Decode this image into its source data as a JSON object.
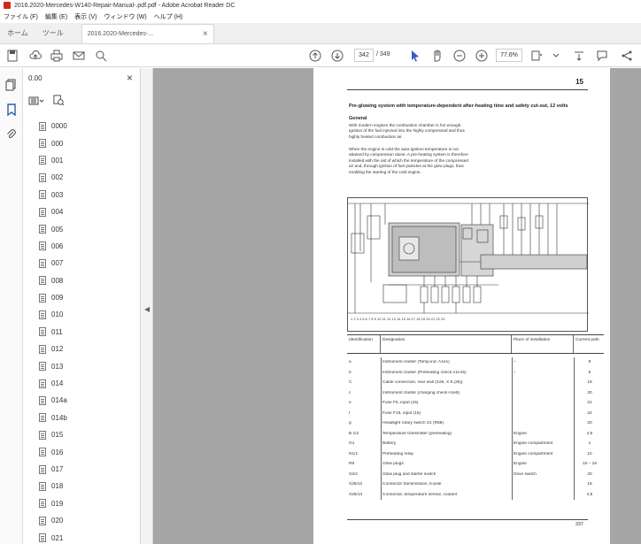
{
  "window": {
    "title": "2016.2020-Mercedes-W140-Repair-Manual-.pdf.pdf - Adobe Acrobat Reader DC"
  },
  "menu": [
    "ファイル (F)",
    "編集 (E)",
    "表示 (V)",
    "ウィンドウ (W)",
    "ヘルプ (H)"
  ],
  "tabs": {
    "home": "ホーム",
    "tools": "ツール",
    "doc": "2016.2020-Mercedes-...",
    "close": "×"
  },
  "toolbar": {
    "page_current": "342",
    "page_total": "/ 349",
    "zoom": "77.6%"
  },
  "panel": {
    "title": "0.00",
    "close": "×",
    "bookmarks": [
      "0000",
      "000",
      "001",
      "002",
      "003",
      "004",
      "005",
      "006",
      "007",
      "008",
      "009",
      "010",
      "011",
      "012",
      "013",
      "014",
      "014a",
      "014b",
      "015",
      "016",
      "017",
      "018",
      "019",
      "020",
      "021"
    ]
  },
  "document": {
    "page_number": "15",
    "heading": "Pre-glowing system with temperature-dependent after-heating time and safety cut-out, 12 volts",
    "section": "General",
    "para1": "With modern engines the combustion chamber is hot enough. Ignition of the fuel injected into the highly compressed and thus highly heated combustion air.",
    "para2": "When the engine is cold the auto-ignition temperature is not attained by compression alone. A pre-heating system is therefore installed with the aid of which the temperature of the compressed air and, through ignition of fuel particles at the glow plugs, thus enabling the starting of the cold engine.",
    "table_headers": [
      "Identification",
      "Designation",
      "Place of installation",
      "Current path"
    ],
    "rows": [
      [
        "a",
        "Instrument cluster (Temp.ind. A1e1)",
        "–",
        "9"
      ],
      [
        "b",
        "Instrument cluster (Preheating check A1e15)",
        "–",
        "5"
      ],
      [
        "C",
        "Cable connection, rear wall (X26, X 9 (26))",
        "",
        "18"
      ],
      [
        "c",
        "Instrument cluster (charging check A1e5)",
        "",
        "20"
      ],
      [
        "e",
        "Fuse F5, input (15)",
        "",
        "21"
      ],
      [
        "f",
        "Fuse F15, input (15)",
        "",
        "22"
      ],
      [
        "g",
        "Headlight rotary switch S1 (R58)",
        "",
        "20"
      ],
      [
        "B 1/2",
        "Temperature transmitter (preheating)",
        "Engine",
        "4,5"
      ],
      [
        "G1",
        "Battery",
        "Engine compartment",
        "1"
      ],
      [
        "N1/1",
        "Preheating relay",
        "Engine compartment",
        "10"
      ],
      [
        "R9",
        "Glow plugs",
        "Engine",
        "10 – 15"
      ],
      [
        "S2/2",
        "Glow plug and starter switch",
        "Drive switch",
        "20"
      ],
      [
        "X26/12",
        "Connector transmission, 6-pole",
        "",
        "16"
      ],
      [
        "X26/13",
        "Connector, temperature sensor, coolant",
        "",
        "4,5"
      ]
    ],
    "footer_number": "337"
  }
}
